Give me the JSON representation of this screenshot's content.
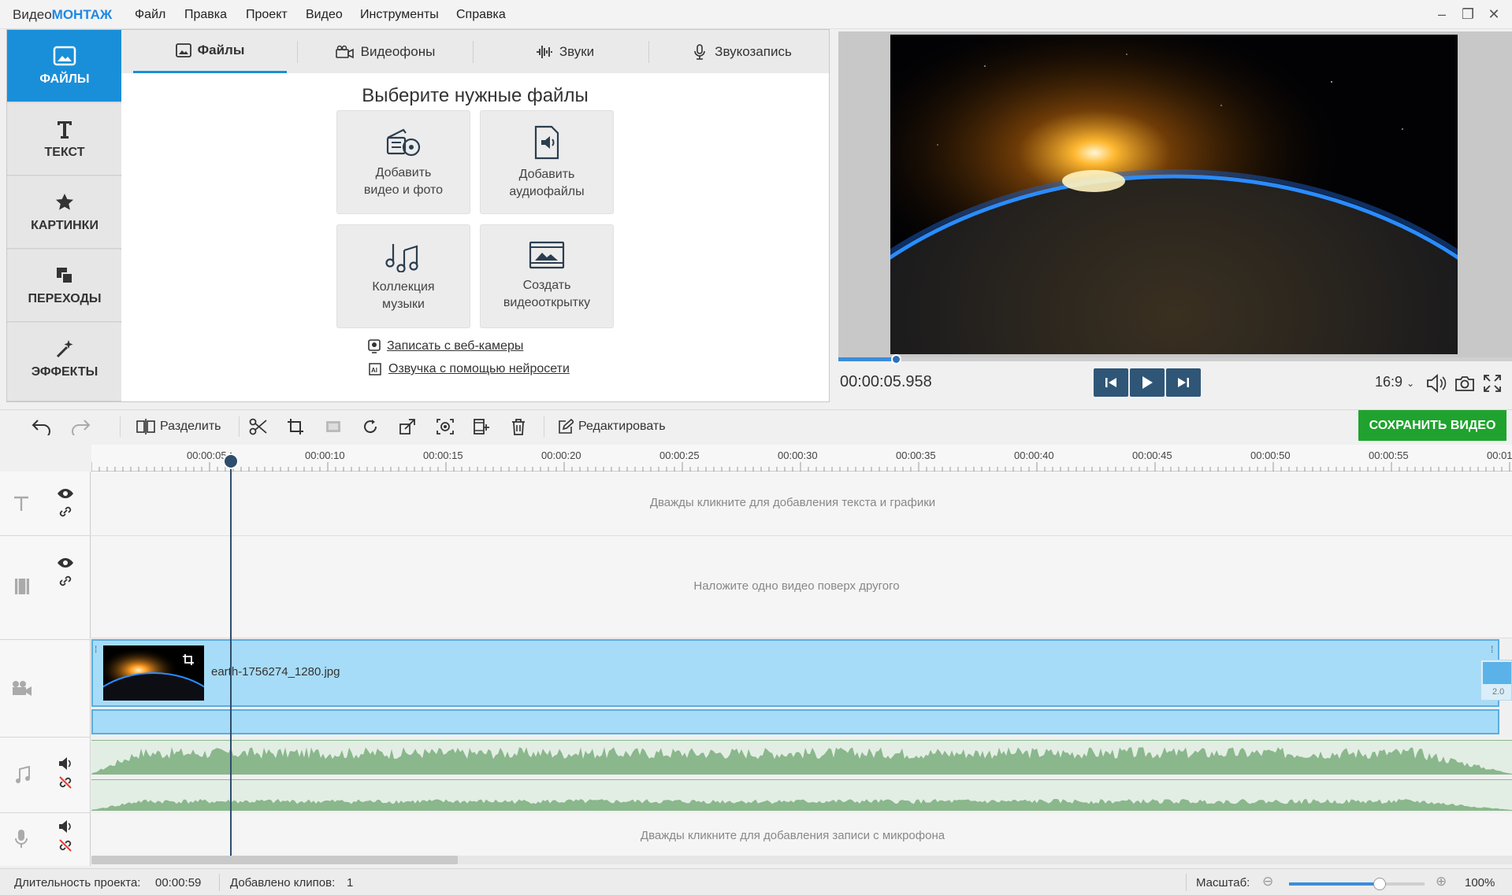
{
  "app": {
    "title_prefix": "Видео",
    "title_brand": "МОНТАЖ"
  },
  "menu": [
    "Файл",
    "Правка",
    "Проект",
    "Видео",
    "Инструменты",
    "Справка"
  ],
  "window_controls": {
    "minimize": "–",
    "restore": "❐",
    "close": "✕"
  },
  "sidebar": {
    "items": [
      {
        "label": "ФАЙЛЫ",
        "icon": "image-icon",
        "active": true
      },
      {
        "label": "ТЕКСТ",
        "icon": "text-icon"
      },
      {
        "label": "КАРТИНКИ",
        "icon": "star-icon"
      },
      {
        "label": "ПЕРЕХОДЫ",
        "icon": "transition-icon"
      },
      {
        "label": "ЭФФЕКТЫ",
        "icon": "magic-wand-icon"
      }
    ]
  },
  "tabs": [
    {
      "label": "Файлы",
      "active": true
    },
    {
      "label": "Видеофоны"
    },
    {
      "label": "Звуки"
    },
    {
      "label": "Звукозапись"
    }
  ],
  "files": {
    "title": "Выберите нужные файлы",
    "tiles": [
      {
        "line1": "Добавить",
        "line2": "видео и фото"
      },
      {
        "line1": "Добавить",
        "line2": "аудиофайлы"
      },
      {
        "line1": "Коллекция",
        "line2": "музыки"
      },
      {
        "line1": "Создать",
        "line2": "видеооткрытку"
      }
    ],
    "links": [
      "Записать с веб-камеры",
      "Озвучка с помощью нейросети"
    ]
  },
  "preview": {
    "timecode": "00:00:05.958",
    "progress_fraction": 0.085,
    "aspect_ratio": "16:9"
  },
  "toolbar": {
    "split_label": "Разделить",
    "edit_label": "Редактировать",
    "save_label": "СОХРАНИТЬ ВИДЕО"
  },
  "ruler": {
    "labels": [
      "00:00:05",
      "00:00:10",
      "00:00:15",
      "00:00:20",
      "00:00:25",
      "00:00:30",
      "00:00:35",
      "00:00:40",
      "00:00:45",
      "00:00:50",
      "00:00:55",
      "00:01"
    ]
  },
  "timeline": {
    "text_hint": "Дважды кликните для добавления текста и графики",
    "overlay_hint": "Наложите одно видео поверх другого",
    "clip_name": "earth-1756274_1280.jpg",
    "transition_badge": "2.0",
    "mic_hint": "Дважды кликните для добавления записи с микрофона"
  },
  "status": {
    "duration_label": "Длительность проекта:",
    "duration_value": "00:00:59",
    "clips_label": "Добавлено клипов:",
    "clips_value": "1",
    "zoom_label": "Масштаб:",
    "zoom_value": "100%",
    "zoom_fraction": 0.67
  },
  "colors": {
    "accent": "#1a8fd9",
    "save": "#1fa32e",
    "clip": "#a6dcf7",
    "audio": "#8ab78c"
  }
}
